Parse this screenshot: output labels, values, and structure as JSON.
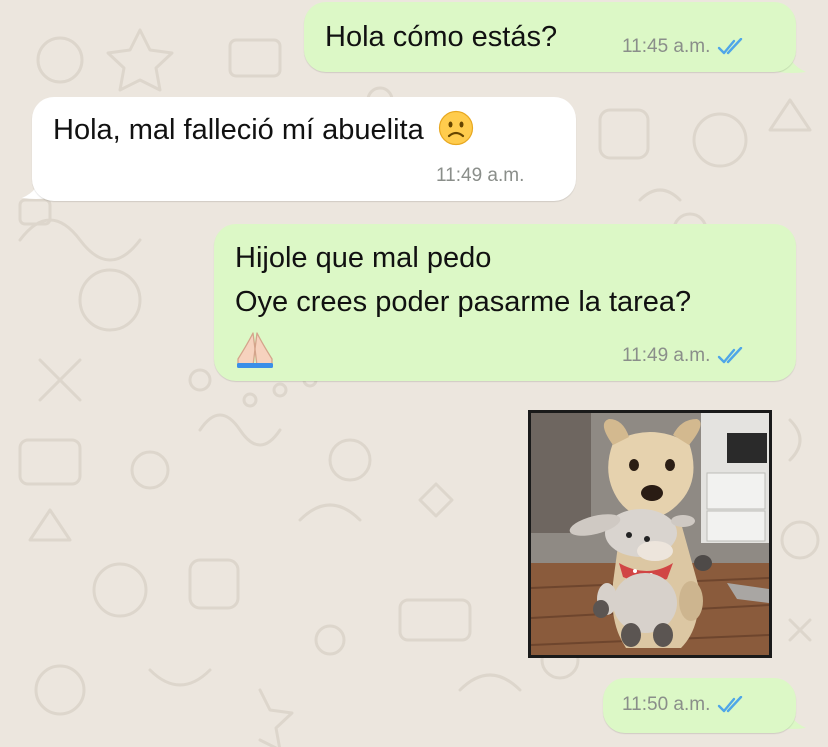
{
  "colors": {
    "background": "#ECE6DE",
    "outgoing_bubble": "#DCF8C6",
    "incoming_bubble": "#FFFFFF",
    "read_ticks": "#4FA6E8",
    "timestamp": "#8A8E8A"
  },
  "messages": [
    {
      "direction": "outgoing",
      "text": "Hola cómo estás?",
      "time": "11:45 a.m.",
      "status": "read-double-check-icon"
    },
    {
      "direction": "incoming",
      "text": "Hola, mal falleció mí abuelita",
      "emoji": "☹️",
      "time": "11:49 a.m."
    },
    {
      "direction": "outgoing",
      "lines": [
        "Hijole que mal pedo",
        "Oye crees poder pasarme la tarea?"
      ],
      "emoji": "🙏🏻",
      "time": "11:49 a.m.",
      "status": "read-double-check-icon"
    },
    {
      "direction": "outgoing",
      "type": "image",
      "image_subject": "dog-holding-plush-toy-photo"
    },
    {
      "direction": "outgoing",
      "type": "empty",
      "time": "11:50 a.m.",
      "status": "read-double-check-icon"
    }
  ]
}
